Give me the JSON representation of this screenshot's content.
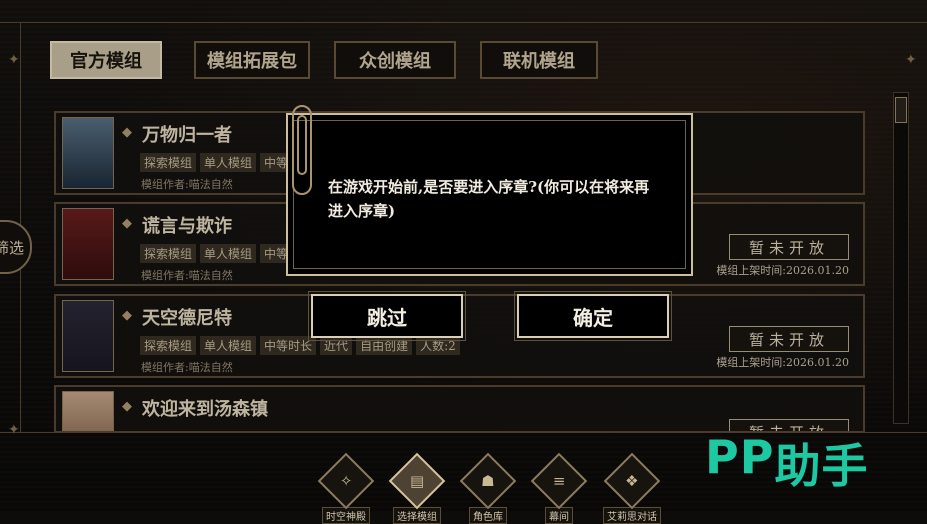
{
  "tabs": [
    {
      "label": "官方模组"
    },
    {
      "label": "模组拓展包"
    },
    {
      "label": "众创模组"
    },
    {
      "label": "联机模组"
    }
  ],
  "filter_label": "筛选",
  "mods": [
    {
      "title": "万物归一者",
      "tags": [
        "探索模组",
        "单人模组",
        "中等"
      ],
      "author": "模组作者:喵法自然",
      "status": "",
      "release": ""
    },
    {
      "title": "谎言与欺诈",
      "tags": [
        "探索模组",
        "单人模组",
        "中等"
      ],
      "author": "模组作者:喵法自然",
      "status": "暂未开放",
      "release": "模组上架时间:2026.01.20"
    },
    {
      "title": "天空德尼特",
      "tags": [
        "探索模组",
        "单人模组",
        "中等时长",
        "近代",
        "自由创建",
        "人数:2"
      ],
      "author": "模组作者:喵法自然",
      "status": "暂未开放",
      "release": "模组上架时间:2026.01.20"
    },
    {
      "title": "欢迎来到汤森镇",
      "tags": [],
      "author": "",
      "status": "暂未开放",
      "release": ""
    }
  ],
  "dialog": {
    "message": "在游戏开始前,是否要进入序章?(你可以在将来再进入序章)",
    "skip_label": "跳过",
    "confirm_label": "确定"
  },
  "nav": [
    {
      "label": "时空神殿",
      "icon": "compass-icon"
    },
    {
      "label": "选择模组",
      "icon": "cards-icon"
    },
    {
      "label": "角色库",
      "icon": "character-card-icon"
    },
    {
      "label": "幕间",
      "icon": "book-stack-icon"
    },
    {
      "label": "艾莉思对话",
      "icon": "dialogue-cards-icon"
    }
  ],
  "watermark": {
    "logo": "PP",
    "text": "助手"
  },
  "colors": {
    "accent": "#cfc2a6",
    "frame": "#6d5b42",
    "watermark": "#1cc9a2"
  }
}
